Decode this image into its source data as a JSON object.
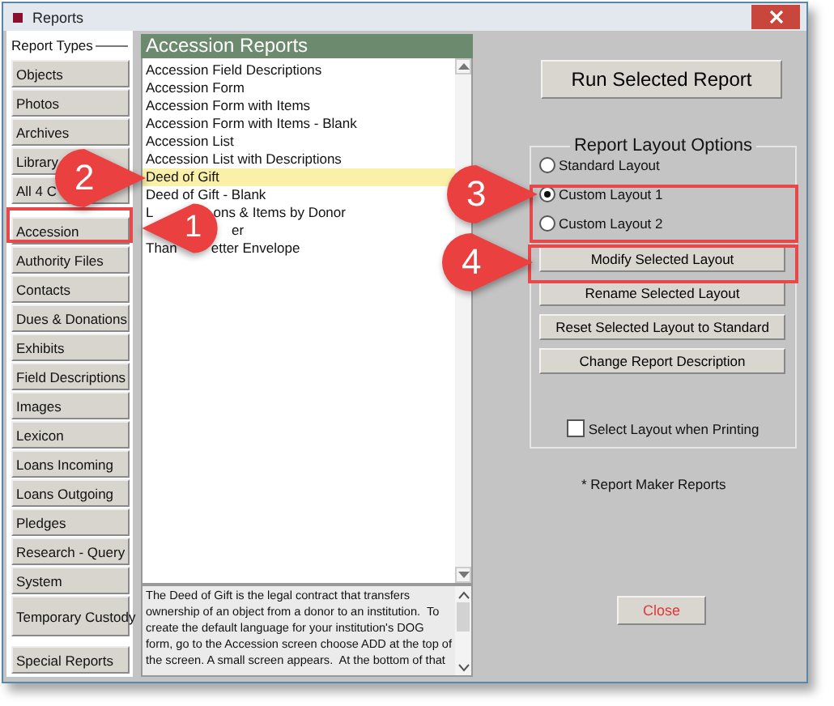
{
  "window": {
    "title": "Reports"
  },
  "sidebar": {
    "heading": "Report Types",
    "items": [
      {
        "label": "Objects"
      },
      {
        "label": "Photos"
      },
      {
        "label": "Archives"
      },
      {
        "label": "Library"
      },
      {
        "label": "All 4 C"
      },
      {
        "label": "Accession"
      },
      {
        "label": "Authority Files"
      },
      {
        "label": "Contacts"
      },
      {
        "label": "Dues & Donations"
      },
      {
        "label": "Exhibits"
      },
      {
        "label": "Field Descriptions"
      },
      {
        "label": "Images"
      },
      {
        "label": "Lexicon"
      },
      {
        "label": "Loans Incoming"
      },
      {
        "label": "Loans Outgoing"
      },
      {
        "label": "Pledges"
      },
      {
        "label": "Research - Query"
      },
      {
        "label": "System"
      },
      {
        "label": "Temporary Custody"
      }
    ],
    "special": {
      "label": "Special Reports"
    }
  },
  "reports": {
    "title": "Accession Reports",
    "items": [
      {
        "parts": [
          "Accession Field Descriptions"
        ],
        "selected": false
      },
      {
        "parts": [
          "Accession Form"
        ],
        "selected": false
      },
      {
        "parts": [
          "Accession Form with Items"
        ],
        "selected": false
      },
      {
        "parts": [
          "Accession Form with Items - Blank"
        ],
        "selected": false
      },
      {
        "parts": [
          "Accession List"
        ],
        "selected": false
      },
      {
        "parts": [
          "Accession List with Descriptions"
        ],
        "selected": false
      },
      {
        "parts": [
          "Deed of Gift"
        ],
        "selected": true
      },
      {
        "parts": [
          "Deed of Gift - Blank"
        ],
        "selected": false
      },
      {
        "parts": [
          "L",
          "ons & Items by Donor"
        ],
        "selected": false
      },
      {
        "parts": [
          "er"
        ],
        "selected": false
      },
      {
        "parts": [
          "Than",
          "etter Envelope"
        ],
        "selected": false
      }
    ],
    "description": "The Deed of Gift is the legal contract that transfers ownership of an object from a donor to an institution.  To create the default language for your institution's DOG form, go to the Accession screen choose ADD at the top of the screen. A small screen appears.  At the bottom of that"
  },
  "run_button": "Run Selected Report",
  "layout_options": {
    "title": "Report Layout Options",
    "radios": [
      {
        "label": "Standard Layout",
        "selected": false
      },
      {
        "label": "Custom Layout 1",
        "selected": true
      },
      {
        "label": "Custom Layout 2",
        "selected": false
      }
    ],
    "buttons": [
      "Modify Selected Layout",
      "Rename Selected Layout",
      "Reset Selected Layout to Standard",
      "Change Report Description"
    ],
    "checkbox": {
      "label": "Select Layout when Printing",
      "checked": false
    }
  },
  "note": "* Report Maker Reports",
  "close_button": "Close",
  "callouts": [
    {
      "label": "1"
    },
    {
      "label": "2"
    },
    {
      "label": "3"
    },
    {
      "label": "4"
    }
  ]
}
